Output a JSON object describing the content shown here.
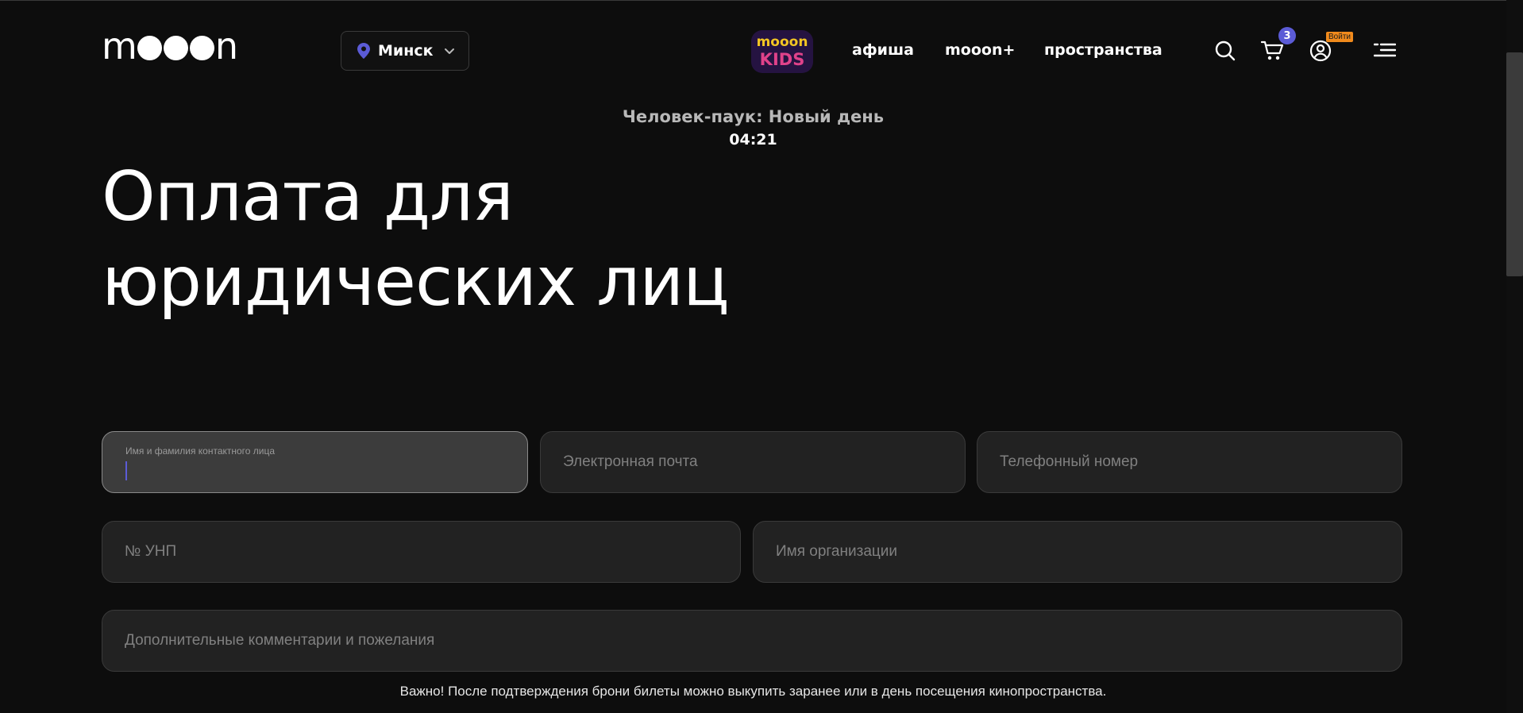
{
  "header": {
    "logo": {
      "prefix": "m",
      "suffix": "n"
    },
    "city": "Минск",
    "nav": {
      "afisha": "афиша",
      "plus": "mooon+",
      "spaces": "пространства"
    },
    "kids_logo": {
      "top": "mooon",
      "bottom": "KIDS"
    },
    "cart_count": "3",
    "login_label": "Войти"
  },
  "session": {
    "movie_title": "Человек-паук: Новый день",
    "timer": "04:21"
  },
  "page_title": "Оплата для юридических лиц",
  "form": {
    "name": {
      "label": "Имя и фамилия контактного лица",
      "value": ""
    },
    "email": {
      "placeholder": "Электронная почта"
    },
    "phone": {
      "placeholder": "Телефонный номер"
    },
    "unp": {
      "placeholder": "№ УНП"
    },
    "org": {
      "placeholder": "Имя организации"
    },
    "comment": {
      "placeholder": "Дополнительные комментарии и пожелания"
    }
  },
  "notice": "Важно! После подтверждения брони билеты можно выкупить заранее или в день посещения кинопространства.",
  "colors": {
    "background": "#0d0d0d",
    "accent": "#5b5bd6",
    "login_badge": "#f08a1c",
    "field_bg": "#222222",
    "field_active_bg": "#3c3c3c"
  },
  "icons": [
    "location-pin-icon",
    "chevron-down-icon",
    "search-icon",
    "cart-icon",
    "user-icon",
    "menu-icon"
  ]
}
